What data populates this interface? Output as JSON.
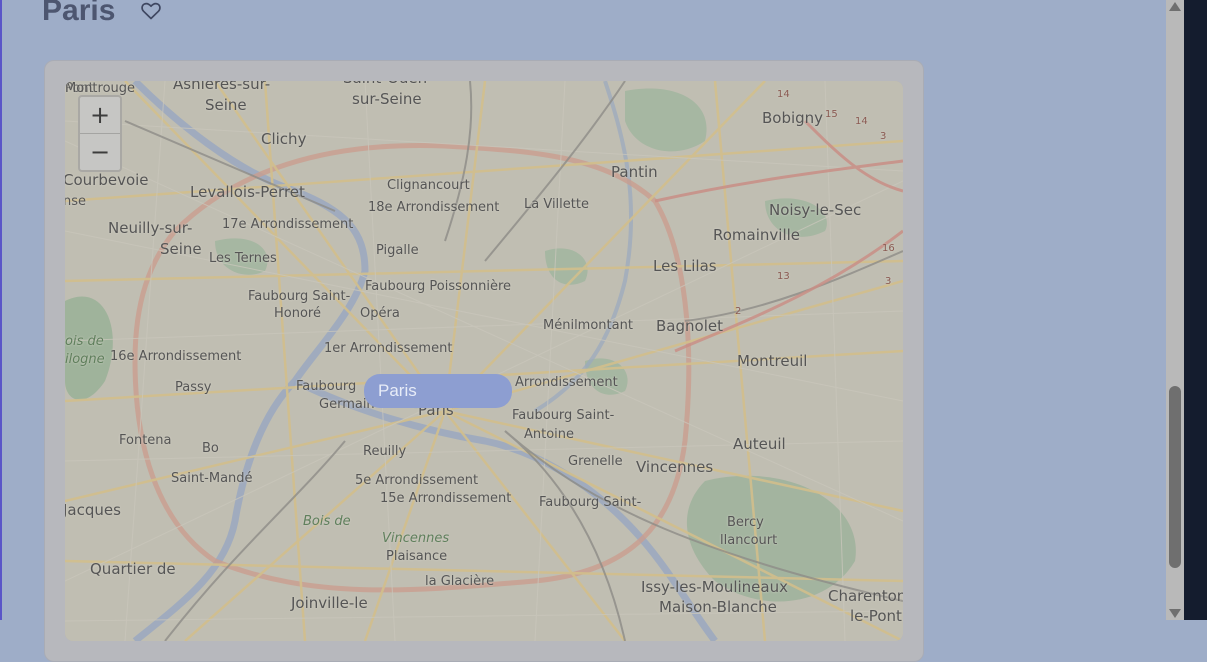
{
  "page": {
    "title": "Paris"
  },
  "map": {
    "zoom_in_label": "+",
    "zoom_out_label": "−",
    "popup_label": "Paris",
    "labels": [
      {
        "text": "Asnieres-sur-"
      },
      {
        "text": "Seine"
      },
      {
        "text": "Saint-Ouen"
      },
      {
        "text": "sur-Seine"
      },
      {
        "text": "Bobigny"
      },
      {
        "text": "Clichy"
      },
      {
        "text": "Pantin"
      },
      {
        "text": "Courbevoie"
      },
      {
        "text": "Levallois-Perret"
      },
      {
        "text": "Clignancourt"
      },
      {
        "text": "18e Arrondissement"
      },
      {
        "text": "La Villette"
      },
      {
        "text": "Noisy-le-Sec"
      },
      {
        "text": "nse"
      },
      {
        "text": "Neuilly-sur-"
      },
      {
        "text": "Seine"
      },
      {
        "text": "17e Arrondissement"
      },
      {
        "text": "Romainville"
      },
      {
        "text": "Pigalle"
      },
      {
        "text": "Les Ternes"
      },
      {
        "text": "Faubourg Poissonnière"
      },
      {
        "text": "Les Lilas"
      },
      {
        "text": "Faubourg Saint-"
      },
      {
        "text": "Honoré"
      },
      {
        "text": "Opéra"
      },
      {
        "text": "Ménilmontant"
      },
      {
        "text": "Bagnolet"
      },
      {
        "text": "ois de"
      },
      {
        "text": "ilogne"
      },
      {
        "text": "16e Arrondissement"
      },
      {
        "text": "1er Arrondissement"
      },
      {
        "text": "Montreuil"
      },
      {
        "text": "Passy"
      },
      {
        "text": "Faubourg"
      },
      {
        "text": "Germain"
      },
      {
        "text": "Arrondissement"
      },
      {
        "text": "Paris"
      },
      {
        "text": "Faubourg Saint-"
      },
      {
        "text": "Antoine"
      },
      {
        "text": "Fontena"
      },
      {
        "text": "Bo"
      },
      {
        "text": "Auteuil"
      },
      {
        "text": "Grenelle"
      },
      {
        "text": "Vincennes"
      },
      {
        "text": "Reuilly"
      },
      {
        "text": "Saint-Mandé"
      },
      {
        "text": "5e Arrondissement"
      },
      {
        "text": "15e Arrondissement"
      },
      {
        "text": "Faubourg Saint-"
      },
      {
        "text": "Jacques"
      },
      {
        "text": "Bercy"
      },
      {
        "text": "llancourt"
      },
      {
        "text": "Bois de"
      },
      {
        "text": "Vincennes"
      },
      {
        "text": "Plaisance"
      },
      {
        "text": "Quartier de"
      },
      {
        "text": "la Glacière"
      },
      {
        "text": "Issy-les-Moulineaux"
      },
      {
        "text": "Maison-Blanche"
      },
      {
        "text": "Charenton-"
      },
      {
        "text": "le-Pont"
      },
      {
        "text": "Joinville-le"
      },
      {
        "text": "Pont"
      },
      {
        "text": "Montrouge"
      }
    ],
    "road_numbers": [
      "14",
      "15",
      "14",
      "3",
      "16",
      "13",
      "3",
      "2"
    ]
  }
}
